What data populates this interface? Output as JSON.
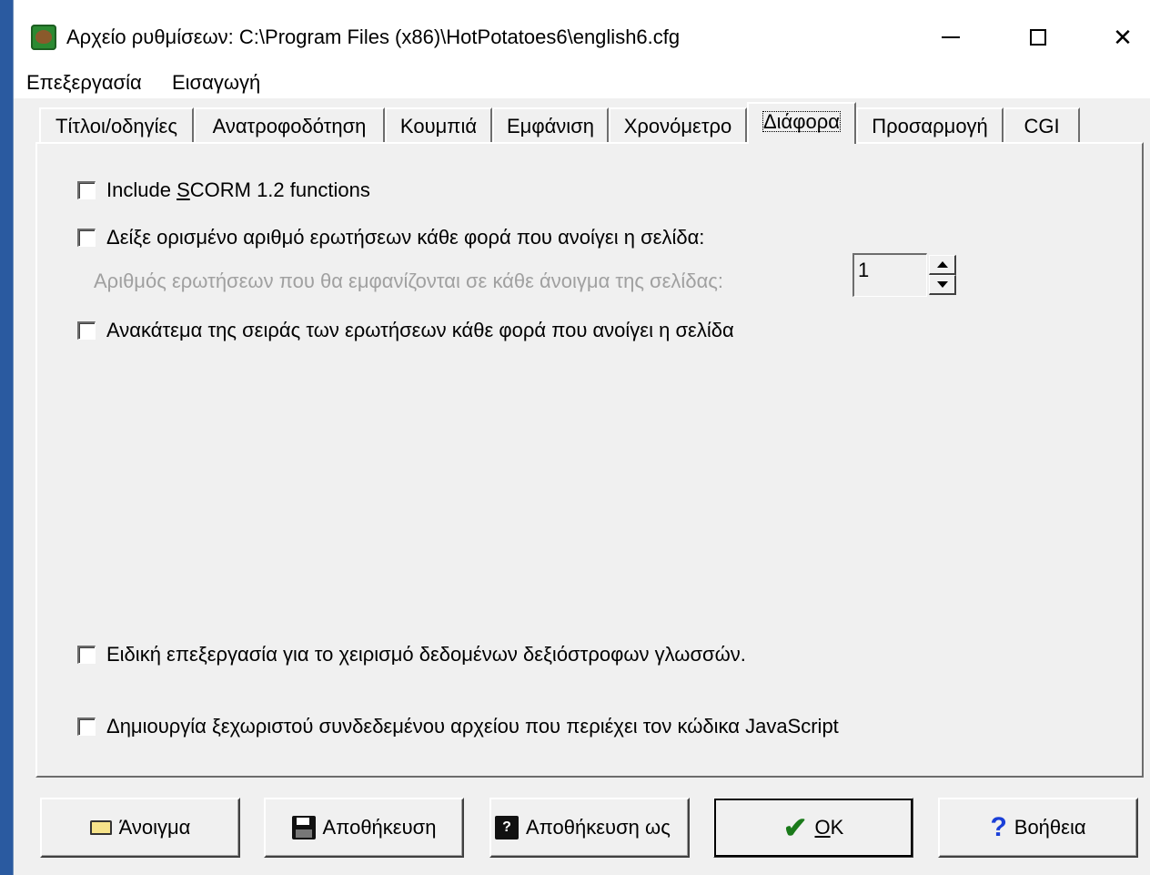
{
  "window": {
    "title": "Αρχείο ρυθμίσεων:  C:\\Program Files (x86)\\HotPotatoes6\\english6.cfg"
  },
  "menu": [
    "Επεξεργασία",
    "Εισαγωγή"
  ],
  "tabs": [
    {
      "label": "Τίτλοι/οδηγίες"
    },
    {
      "label": "Ανατροφοδότηση"
    },
    {
      "label": "Κουμπιά"
    },
    {
      "label": "Εμφάνιση"
    },
    {
      "label": "Χρονόμετρο"
    },
    {
      "label": "Διάφορα"
    },
    {
      "label": "Προσαρμογή"
    },
    {
      "label": "CGI"
    }
  ],
  "active_tab": "Διάφορα",
  "options": {
    "scorm": {
      "pre": "Include ",
      "accel": "S",
      "post": "CORM 1.2 functions",
      "checked": false
    },
    "show_n": {
      "label": "Δείξε ορισμένο αριθμό ερωτήσεων κάθε φορά που ανοίγει η σελίδα:",
      "checked": false
    },
    "num_questions": {
      "label": "Αριθμός ερωτήσεων που θα εμφανίζονται σε κάθε άνοιγμα της σελίδας:",
      "value": "1"
    },
    "shuffle": {
      "label": "Ανακάτεμα της σειράς των ερωτήσεων κάθε φορά που ανοίγει η σελίδα",
      "checked": false
    },
    "rtl": {
      "label": "Ειδική επεξεργασία για το χειρισμό δεδομένων δεξιόστροφων γλωσσών.",
      "checked": false
    },
    "separate_js": {
      "label": "Δημιουργία ξεχωριστού συνδεδεμένου αρχείου που περιέχει τον κώδικα JavaScript",
      "checked": false
    }
  },
  "buttons": {
    "open": "Άνοιγμα",
    "save": "Αποθήκευση",
    "save_as": "Αποθήκευση ως",
    "ok_accel": "O",
    "ok_rest": "K",
    "help": "Βοήθεια"
  },
  "icons": {
    "app": "hot-potatoes-icon",
    "open": "folder-open-icon",
    "save": "floppy-disk-icon",
    "save_as": "floppy-disk-question-icon",
    "ok": "checkmark-icon",
    "help": "question-mark-icon"
  }
}
